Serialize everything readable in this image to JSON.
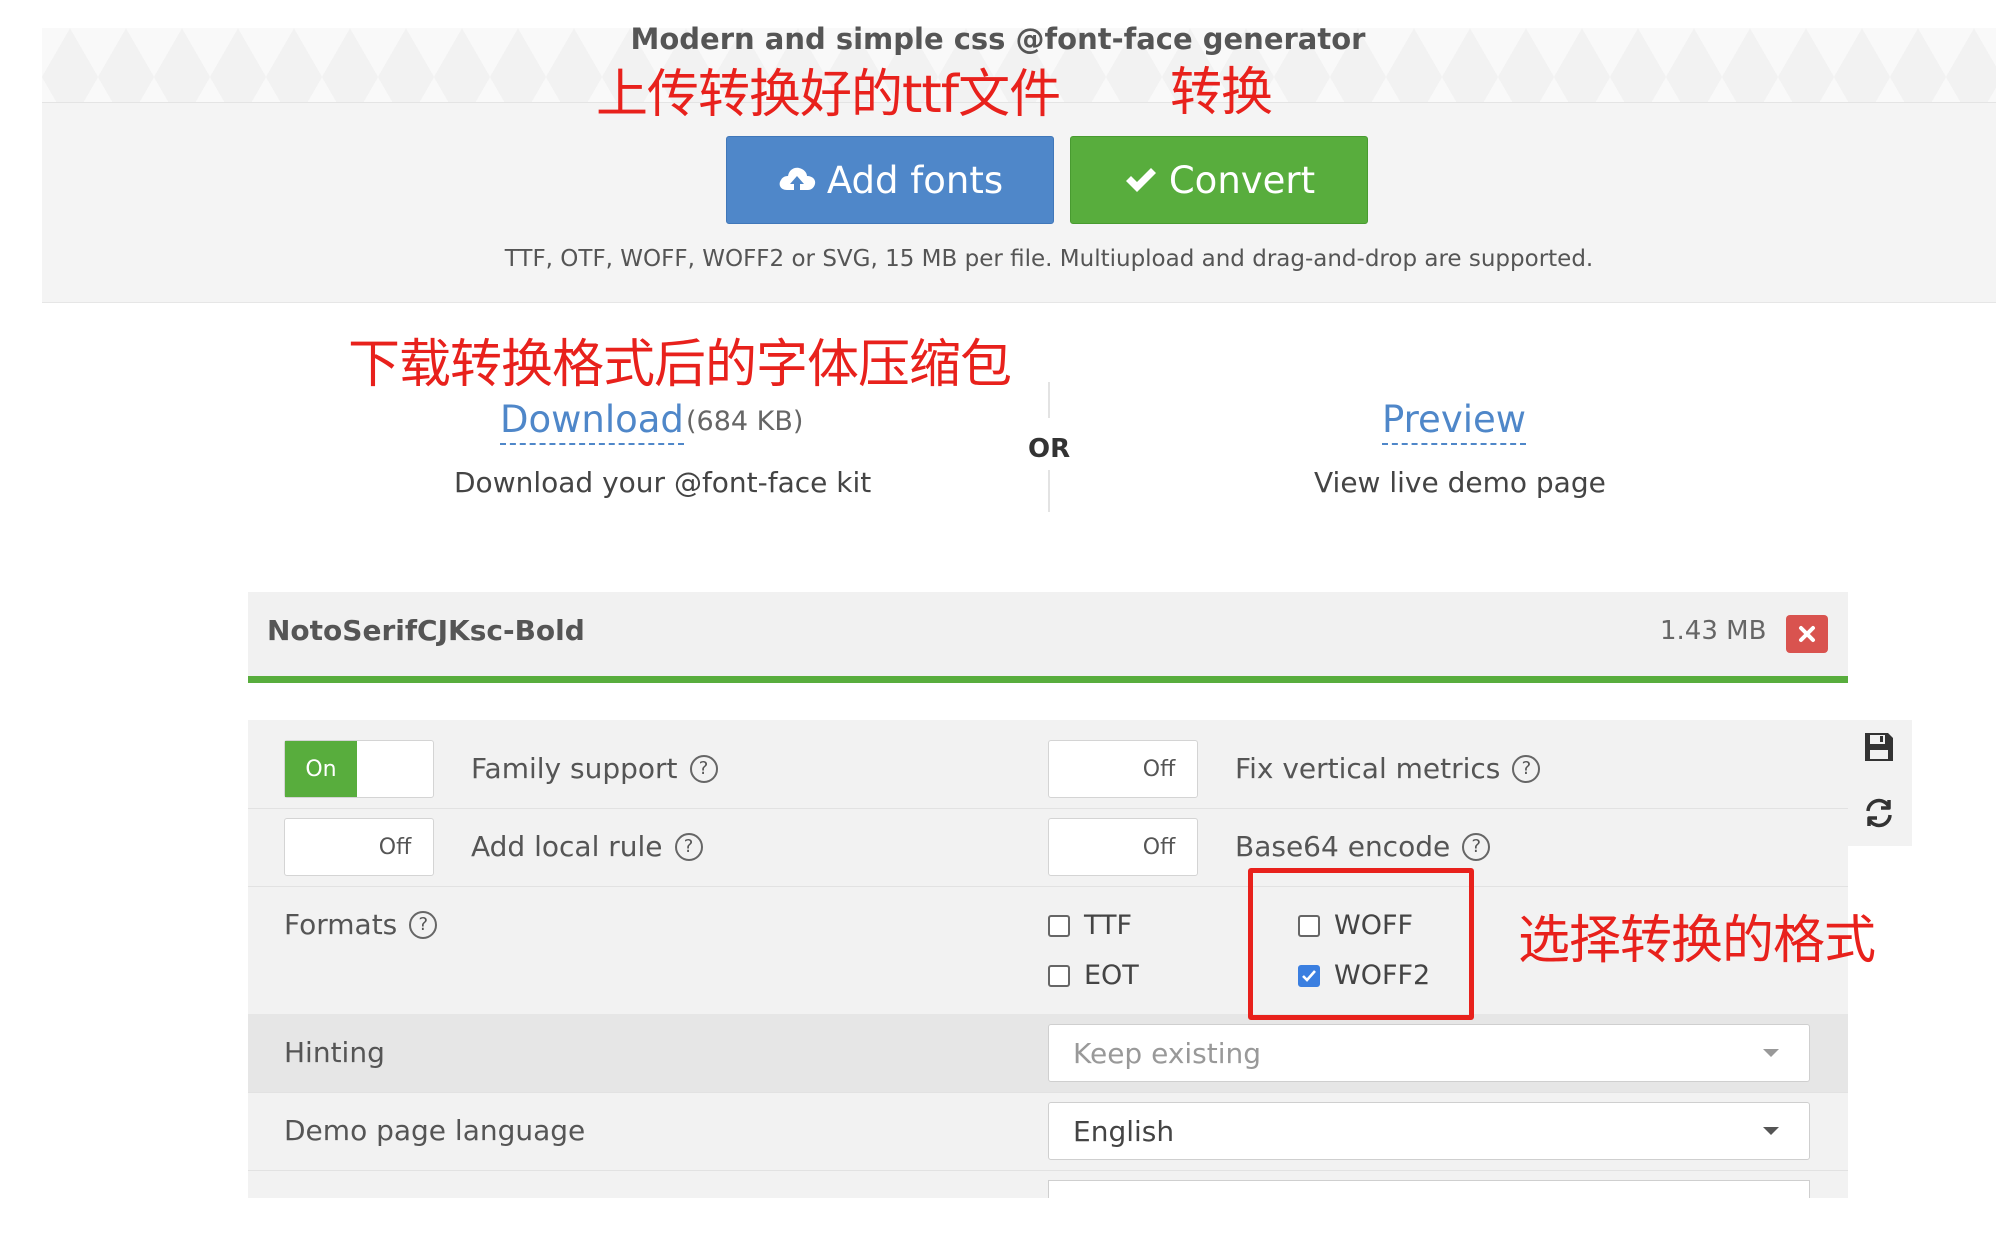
{
  "header": {
    "tagline": "Modern and simple css @font-face generator",
    "upload_note": "TTF, OTF, WOFF, WOFF2 or SVG, 15 MB per file. Multiupload and drag-and-drop are supported."
  },
  "toolbar": {
    "add_fonts_label": "Add fonts",
    "convert_label": "Convert"
  },
  "annotations": {
    "upload": "上传转换好的ttf文件",
    "convert": "转换",
    "download_pack": "下载转换格式后的字体压缩包",
    "choose_format": "选择转换的格式"
  },
  "result": {
    "download_label": "Download",
    "download_size": "(684 KB)",
    "download_desc": "Download your @font-face kit",
    "or_label": "OR",
    "preview_label": "Preview",
    "preview_desc": "View live demo page"
  },
  "font_file": {
    "name": "NotoSerifCJKsc-Bold",
    "size": "1.43 MB"
  },
  "options": {
    "family_support": {
      "label": "Family support",
      "state": "On"
    },
    "add_local_rule": {
      "label": "Add local rule",
      "state": "Off"
    },
    "fix_vertical_metrics": {
      "label": "Fix vertical metrics",
      "state": "Off"
    },
    "base64_encode": {
      "label": "Base64 encode",
      "state": "Off"
    },
    "formats_label": "Formats",
    "formats": [
      {
        "label": "TTF",
        "checked": false
      },
      {
        "label": "EOT",
        "checked": false
      },
      {
        "label": "WOFF",
        "checked": false
      },
      {
        "label": "WOFF2",
        "checked": true
      }
    ],
    "hinting": {
      "label": "Hinting",
      "value": "Keep existing"
    },
    "demo_language": {
      "label": "Demo page language",
      "value": "English"
    }
  },
  "colors": {
    "accent_blue": "#4f87c9",
    "accent_green": "#58ad3d",
    "danger": "#d9534f",
    "annotation_red": "#e8211c"
  }
}
